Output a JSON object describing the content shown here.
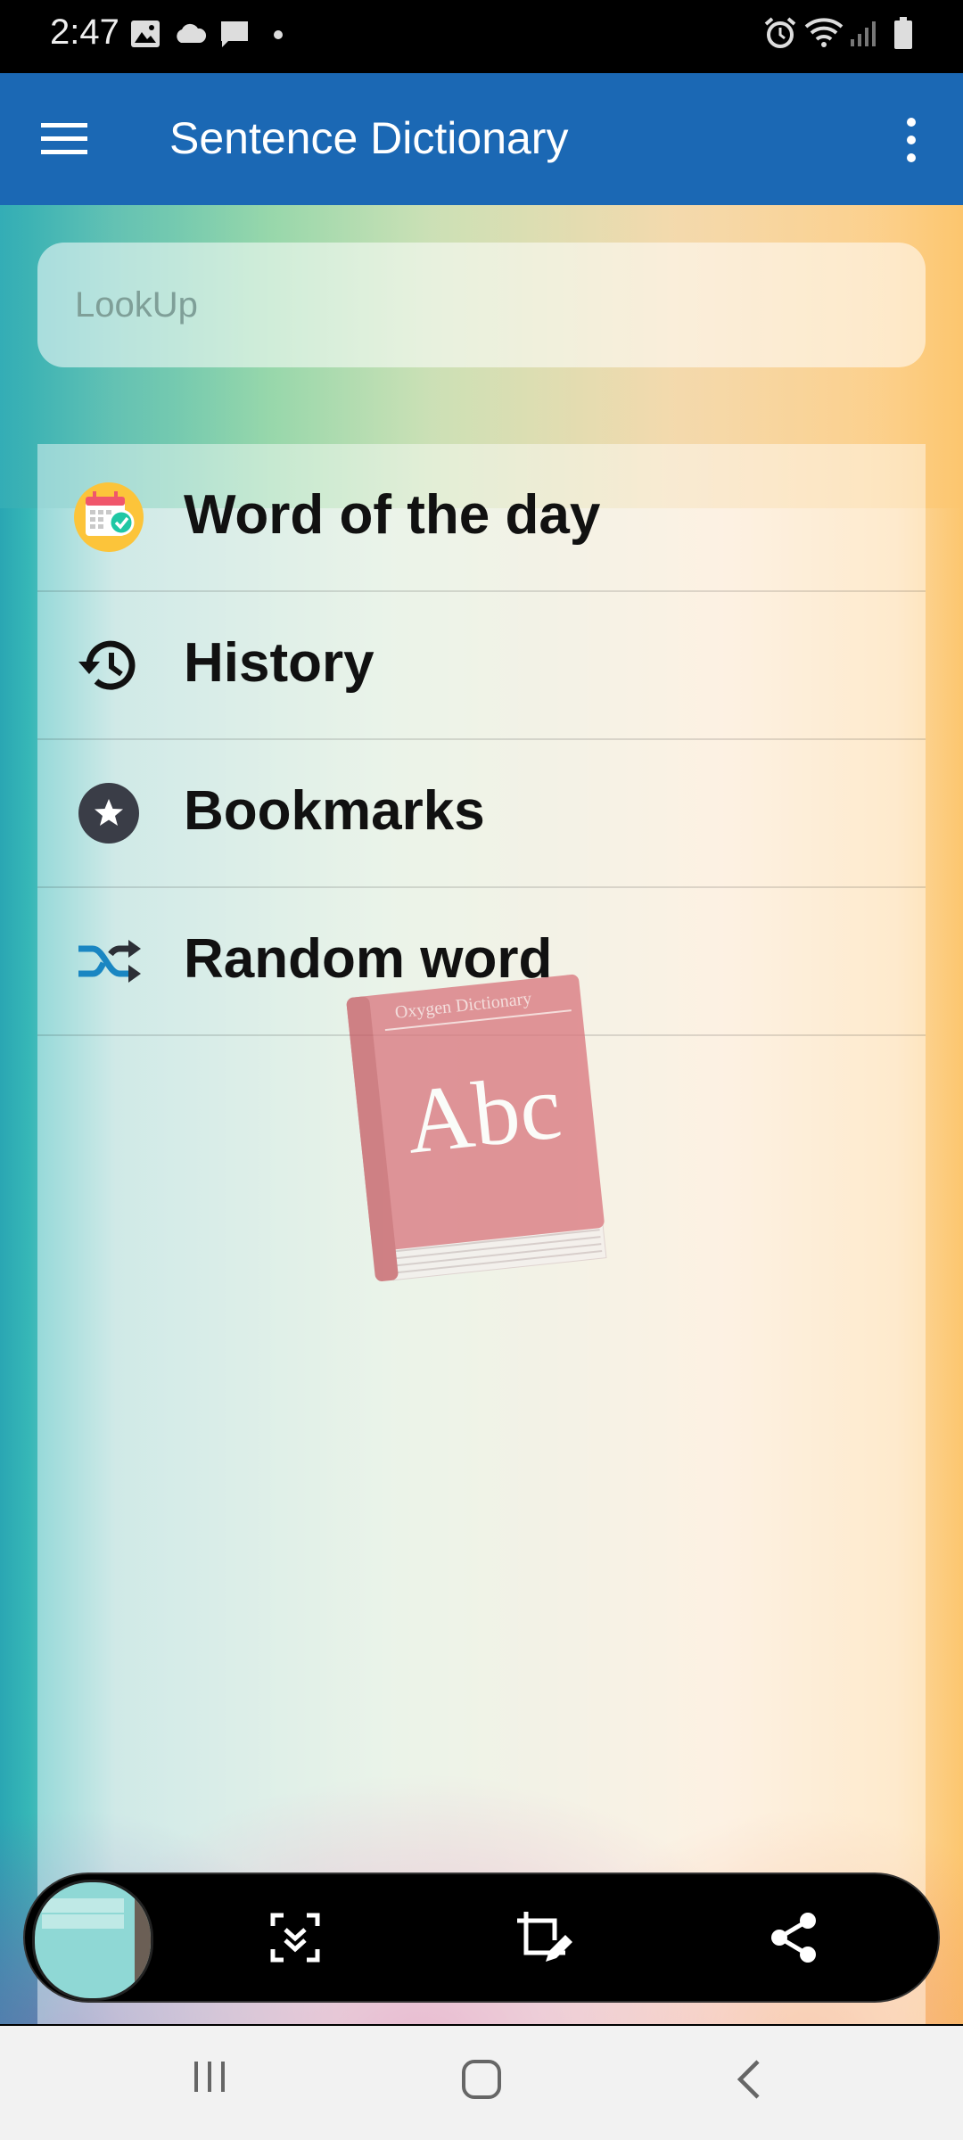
{
  "status_bar": {
    "time": "2:47",
    "left_icons": [
      "image-icon",
      "cloud-icon",
      "message-icon",
      "dot-icon"
    ],
    "right_icons": [
      "alarm-icon",
      "wifi-icon",
      "signal-icon",
      "battery-icon"
    ]
  },
  "app_bar": {
    "title": "Sentence Dictionary",
    "menu_icon": "hamburger-menu-icon",
    "overflow_icon": "more-vert-icon",
    "color": "#1b68b4"
  },
  "search": {
    "placeholder": "LookUp"
  },
  "menu": {
    "items": [
      {
        "label": "Word of the day",
        "icon": "calendar-check-icon"
      },
      {
        "label": "History",
        "icon": "history-icon"
      },
      {
        "label": "Bookmarks",
        "icon": "star-circle-icon"
      },
      {
        "label": "Random word",
        "icon": "shuffle-icon"
      }
    ]
  },
  "illustration": {
    "book_title": "Oxygen Dictionary",
    "book_text": "Abc"
  },
  "screenshot_toolbar": {
    "icons": [
      "screenshot-thumbnail",
      "scroll-capture-icon",
      "crop-edit-icon",
      "share-icon"
    ]
  },
  "nav_bar": {
    "icons": [
      "recents-icon",
      "home-icon",
      "back-icon"
    ]
  }
}
